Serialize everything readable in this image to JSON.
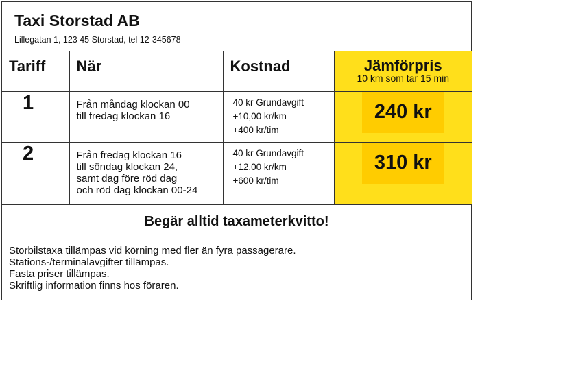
{
  "header": {
    "company": "Taxi Storstad AB",
    "address": "Lillegatan 1, 123 45 Storstad, tel 12-345678"
  },
  "table": {
    "columns": {
      "tariff": "Tariff",
      "when": "När",
      "cost": "Kostnad",
      "comparison": "Jämförpris",
      "comparison_sub": "10 km som tar 15 min"
    },
    "rows": [
      {
        "tariff": "1",
        "when": "Från måndag klockan 00\ntill fredag klockan 16",
        "cost": [
          "40 kr Grundavgift",
          "+10,00 kr/km",
          "+400 kr/tim"
        ],
        "price": "240 kr"
      },
      {
        "tariff": "2",
        "when": "Från fredag klockan 16\ntill söndag klockan 24,\nsamt dag före röd dag\noch röd dag klockan 00-24",
        "cost": [
          "40 kr Grundavgift",
          "+12,00 kr/km",
          "+600 kr/tim"
        ],
        "price": "310 kr"
      }
    ]
  },
  "notice": "Begär alltid taxameterkvitto!",
  "footer": [
    "Storbilstaxa tillämpas vid körning med fler än fyra passagerare.",
    "Stations-/terminalavgifter tillämpas.",
    "Fasta priser tillämpas.",
    "Skriftlig information finns hos föraren."
  ],
  "colors": {
    "highlight": "#ffdf1b",
    "price_box": "#ffcc00",
    "border": "#333333"
  }
}
